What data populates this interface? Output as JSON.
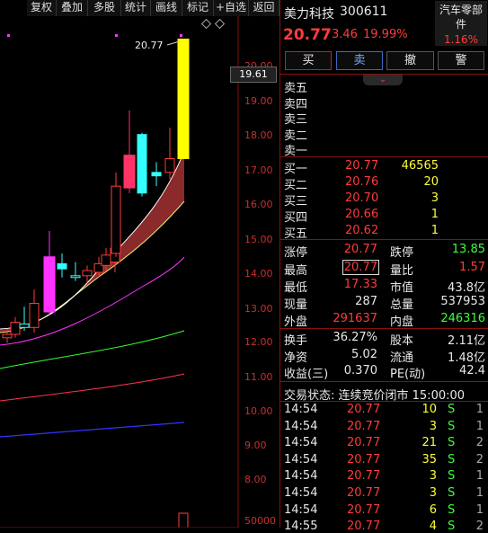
{
  "toolbar": {
    "items": [
      "复权",
      "叠加",
      "多股",
      "统计",
      "画线",
      "标记",
      "+自选",
      "返回"
    ]
  },
  "chart": {
    "price_labels": [
      "20.00",
      "19.00",
      "18.00",
      "17.00",
      "16.00",
      "15.00",
      "14.00",
      "13.00",
      "12.00",
      "11.00",
      "10.00",
      "9.00",
      "8.00"
    ],
    "volume_label": "50000",
    "current_price_tag": "19.61",
    "high_annotation": "20.77",
    "candles": [
      {
        "o": 12.1,
        "h": 12.35,
        "l": 11.95,
        "c": 12.2
      },
      {
        "o": 12.2,
        "h": 12.7,
        "l": 12.1,
        "c": 12.55
      },
      {
        "o": 12.5,
        "h": 13.0,
        "l": 12.3,
        "c": 12.4
      },
      {
        "o": 12.4,
        "h": 13.5,
        "l": 12.25,
        "c": 13.1
      },
      {
        "o": 12.85,
        "h": 15.2,
        "l": 12.75,
        "c": 14.45
      },
      {
        "o": 14.25,
        "h": 14.55,
        "l": 13.85,
        "c": 14.1
      },
      {
        "o": 13.9,
        "h": 14.3,
        "l": 13.75,
        "c": 13.85
      },
      {
        "o": 13.9,
        "h": 14.2,
        "l": 13.7,
        "c": 14.05
      },
      {
        "o": 14.0,
        "h": 14.45,
        "l": 13.85,
        "c": 14.25
      },
      {
        "o": 14.2,
        "h": 14.7,
        "l": 14.05,
        "c": 14.5
      },
      {
        "o": 14.3,
        "h": 14.7,
        "l": 14.0,
        "c": 14.7
      },
      {
        "o": 14.55,
        "h": 16.9,
        "l": 14.45,
        "c": 16.5
      },
      {
        "o": 16.45,
        "h": 18.7,
        "l": 16.3,
        "c": 17.4
      },
      {
        "o": 17.4,
        "h": 17.8,
        "l": 17.0,
        "c": 17.7
      },
      {
        "o": 18.0,
        "h": 18.05,
        "l": 16.2,
        "c": 16.3
      },
      {
        "o": 16.8,
        "h": 17.2,
        "l": 16.5,
        "c": 16.9
      },
      {
        "o": 16.9,
        "h": 18.2,
        "l": 16.7,
        "c": 17.3
      },
      {
        "o": 17.3,
        "h": 20.77,
        "l": 17.3,
        "c": 20.77
      }
    ],
    "volume_bar": 52000
  },
  "stock": {
    "name": "美力科技",
    "code": "300611",
    "price": "20.77",
    "change": "3.46",
    "change_pct": "19.99%",
    "sector": "汽车零部件",
    "sector_pct": "1.16%"
  },
  "buttons": [
    "买",
    "卖",
    "撤",
    "警"
  ],
  "sell_levels": [
    "卖五",
    "卖四",
    "卖三",
    "卖二",
    "卖一"
  ],
  "buy_levels": [
    {
      "label": "买一",
      "price": "20.77",
      "vol": "46565"
    },
    {
      "label": "买二",
      "price": "20.76",
      "vol": "20"
    },
    {
      "label": "买三",
      "price": "20.70",
      "vol": "3"
    },
    {
      "label": "买四",
      "price": "20.66",
      "vol": "1"
    },
    {
      "label": "买五",
      "price": "20.62",
      "vol": "1"
    }
  ],
  "stats": {
    "zhangting_l": "涨停",
    "zhangting": "20.77",
    "dieting_l": "跌停",
    "dieting": "13.85",
    "high_l": "最高",
    "high": "20.77",
    "liangbi_l": "量比",
    "liangbi": "1.57",
    "low_l": "最低",
    "low": "17.33",
    "shizhi_l": "市值",
    "shizhi": "43.8亿",
    "xianliang_l": "现量",
    "xianliang": "287",
    "zongliang_l": "总量",
    "zongliang": "537953",
    "waipan_l": "外盘",
    "waipan": "291637",
    "neipan_l": "内盘",
    "neipan": "246316"
  },
  "stats2": {
    "huanshou_l": "换手",
    "huanshou": "36.27%",
    "guben_l": "股本",
    "guben": "2.11亿",
    "jingzi_l": "净资",
    "jingzi": "5.02",
    "liutong_l": "流通",
    "liutong": "1.48亿",
    "shouyi_l": "收益(三)",
    "shouyi": "0.370",
    "pe_l": "PE(动)",
    "pe": "42.4"
  },
  "trade_status": "交易状态: 连续竞价闭市 15:00:00",
  "ticks": [
    {
      "time": "14:54",
      "price": "20.77",
      "vol": "10",
      "side": "S",
      "n": "1"
    },
    {
      "time": "14:54",
      "price": "20.77",
      "vol": "3",
      "side": "S",
      "n": "1"
    },
    {
      "time": "14:54",
      "price": "20.77",
      "vol": "21",
      "side": "S",
      "n": "2"
    },
    {
      "time": "14:54",
      "price": "20.77",
      "vol": "35",
      "side": "S",
      "n": "2"
    },
    {
      "time": "14:54",
      "price": "20.77",
      "vol": "3",
      "side": "S",
      "n": "1"
    },
    {
      "time": "14:54",
      "price": "20.77",
      "vol": "3",
      "side": "S",
      "n": "1"
    },
    {
      "time": "14:54",
      "price": "20.77",
      "vol": "6",
      "side": "S",
      "n": "1"
    },
    {
      "time": "14:55",
      "price": "20.77",
      "vol": "4",
      "side": "S",
      "n": "2"
    }
  ]
}
